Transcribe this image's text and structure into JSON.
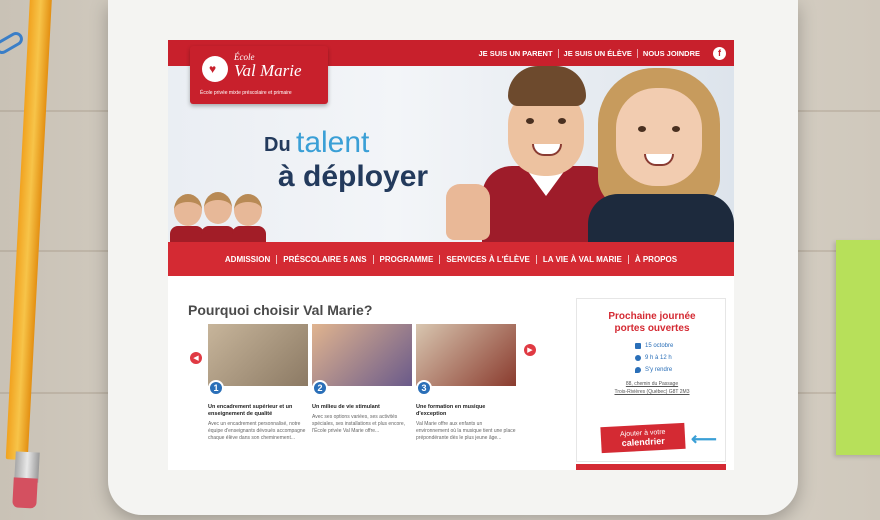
{
  "header": {
    "top_links": [
      "JE SUIS UN PARENT",
      "JE SUIS UN ÉLÈVE",
      "NOUS JOINDRE"
    ],
    "facebook_icon": "facebook-icon",
    "logo": {
      "ecole": "École",
      "name": "Val Marie",
      "subtitle": "École privée mixte préscolaire et primaire"
    }
  },
  "hero": {
    "du": "Du",
    "talent": "talent",
    "a_deployer": "à déployer"
  },
  "nav": {
    "items": [
      "ADMISSION",
      "PRÉSCOLAIRE 5 ANS",
      "PROGRAMME",
      "SERVICES À L'ÉLÈVE",
      "LA VIE À VAL MARIE",
      "À PROPOS"
    ]
  },
  "why": {
    "title": "Pourquoi choisir Val Marie?",
    "cards": [
      {
        "num": "1",
        "title": "Un encadrement supérieur et un enseignement de qualité",
        "text": "Avec un encadrement personnalisé, notre équipe d'enseignants dévoués accompagne chaque élève dans son cheminement..."
      },
      {
        "num": "2",
        "title": "Un milieu de vie stimulant",
        "text": "Avec ses options variées, ses activités spéciales, ses installations et plus encore, l'École privée Val Marie offre..."
      },
      {
        "num": "3",
        "title": "Une formation en musique d'exception",
        "text": "Val Marie offre aux enfants un environnement où la musique tient une place prépondérante dès le plus jeune âge..."
      }
    ]
  },
  "open_house": {
    "title_line1": "Prochaine journée",
    "title_line2": "portes ouvertes",
    "date": "15 octobre",
    "time": "9 h à 12 h",
    "location": "S'y rendre",
    "address_line1": "88, chemin du Passage",
    "address_line2": "Trois-Rivières (Québec) G8T 2M3",
    "button_line1": "Ajouter à votre",
    "button_line2": "calendrier"
  },
  "colors": {
    "brand_red": "#c8202c",
    "nav_red": "#d42a33",
    "accent_blue": "#3a9fd6",
    "navy": "#233a5c"
  }
}
